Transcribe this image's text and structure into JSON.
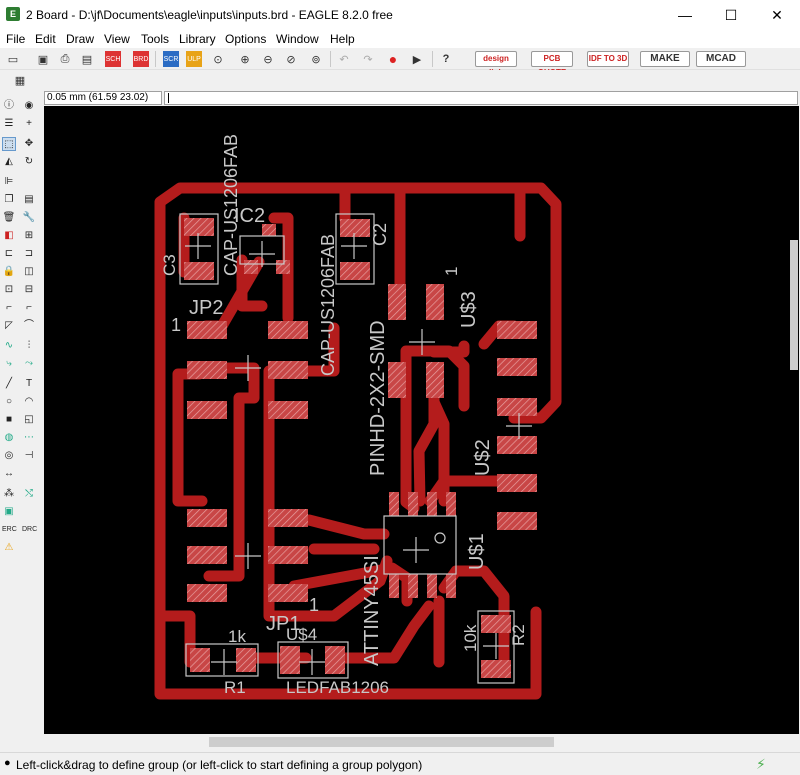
{
  "window": {
    "title": "2 Board - D:\\jf\\Documents\\eagle\\inputs\\inputs.brd - EAGLE 8.2.0 free",
    "minimize": "—",
    "maximize": "☐",
    "close": "✕"
  },
  "menu": [
    "File",
    "Edit",
    "Draw",
    "View",
    "Tools",
    "Library",
    "Options",
    "Window",
    "Help"
  ],
  "toolbar": {
    "badges": [
      "design link",
      "PCB QUOTE",
      "IDF TO 3D",
      "MAKE",
      "MCAD"
    ]
  },
  "coordinates": "0.05 mm (61.59 23.02)",
  "board": {
    "labels": {
      "c3": "C3",
      "c3_value": "CAP-US1206FAB",
      "ic2": "IC2",
      "c2": "C2",
      "c2_value": "CAP-US1206FAB",
      "jp2": "JP2",
      "jp2_pin1": "1",
      "u3": "U$3",
      "u3_pin1": "1",
      "u3_value": "PINHD-2X2-SMD",
      "u2": "U$2",
      "u1": "U$1",
      "u1_value": "ATTINY45SI",
      "jp1": "JP1",
      "jp1_pin1": "1",
      "r1_value": "1k",
      "r1": "R1",
      "u4": "U$4",
      "u4_value": "LEDFAB1206",
      "r2": "R2",
      "r2_value": "10k"
    },
    "colors": {
      "background": "#000000",
      "trace": "#b41c1c",
      "pad": "#c84646",
      "silk": "#c8c8c8"
    }
  },
  "status": {
    "message": "Left-click&drag to define group (or left-click to start defining a group polygon)"
  }
}
